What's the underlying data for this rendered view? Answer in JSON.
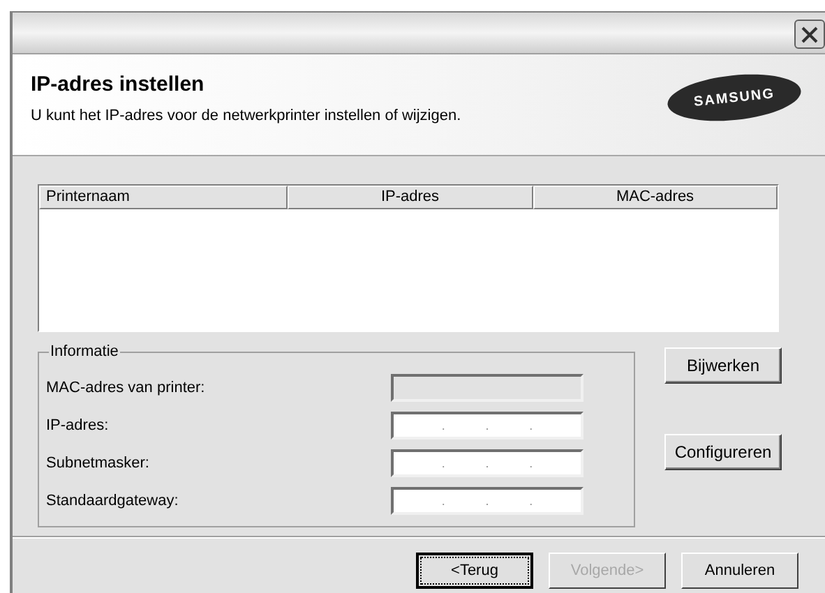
{
  "header": {
    "title": "IP-adres instellen",
    "subtitle": "U kunt het IP-adres voor de netwerkprinter instellen of wijzigen.",
    "logo": "SAMSUNG"
  },
  "table": {
    "columns": [
      "Printernaam",
      "IP-adres",
      "MAC-adres"
    ]
  },
  "group": {
    "title": "Informatie",
    "fields": [
      {
        "label": "MAC-adres van printer:",
        "kind": "plain",
        "disabled": true
      },
      {
        "label": "IP-adres:",
        "kind": "ip",
        "disabled": false,
        "separators": [
          ".",
          ".",
          "."
        ]
      },
      {
        "label": "Subnetmasker:",
        "kind": "ip",
        "disabled": false,
        "separators": [
          ".",
          ".",
          "."
        ]
      },
      {
        "label": "Standaardgateway:",
        "kind": "ip",
        "disabled": false,
        "separators": [
          ".",
          ".",
          "."
        ]
      }
    ]
  },
  "side_buttons": [
    "Bijwerken",
    "Configureren"
  ],
  "buttons": [
    {
      "label": "<Terug",
      "disabled": false,
      "default": true
    },
    {
      "label": "Volgende>",
      "disabled": true,
      "default": false
    },
    {
      "label": "Annuleren",
      "disabled": false,
      "default": false
    }
  ]
}
